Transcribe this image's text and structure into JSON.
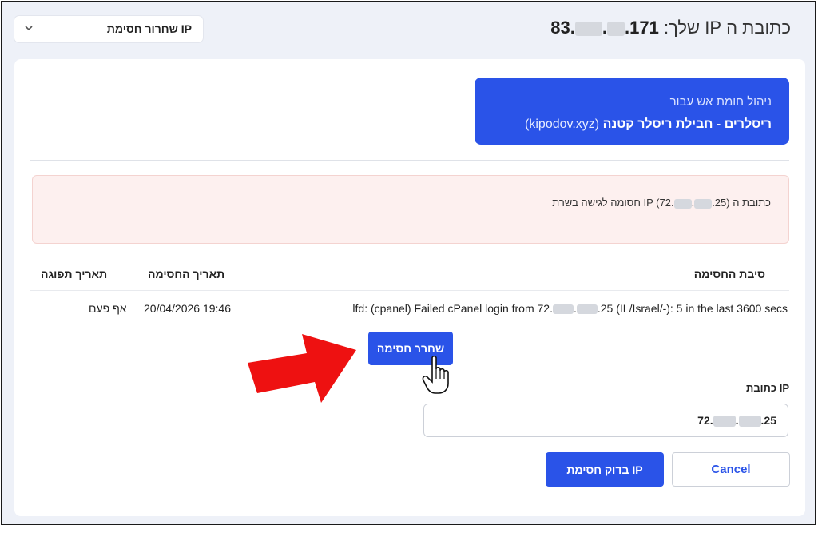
{
  "header": {
    "ip_label": "כתובת ה IP שלך:",
    "ip_prefix": "83.",
    "ip_suffix": ".171",
    "dropdown_label": "שחרור חסימת IP"
  },
  "brand": {
    "subtitle": "ניהול חומת אש עבור",
    "title": "ריסלרים - חבילת ריסלר קטנה",
    "domain": "(kipodov.xyz)"
  },
  "alert": {
    "text_start": "כתובת ה IP (72.",
    "text_end": ".25) חסומה לגישה בשרת"
  },
  "table": {
    "headers": {
      "reason": "סיבת החסימה",
      "block_date": "תאריך החסימה",
      "expiry_date": "תאריך תפוגה"
    },
    "row": {
      "reason_start": "lfd: (cpanel) Failed cPanel login from 72.",
      "reason_end": ".25 (IL/Israel/-): 5 in the last 3600 secs",
      "block_date": "20/04/2026 19:46",
      "expiry_date": "אף פעם"
    },
    "release_label": "שחרר חסימה"
  },
  "form": {
    "ip_label": "כתובת IP",
    "ip_prefix": "72.",
    "ip_suffix": ".25",
    "check_label": "בדוק חסימת IP",
    "cancel_label": "Cancel"
  },
  "colors": {
    "accent": "#2a53e8",
    "alert_bg": "#fdf0ef",
    "arrow": "#ee1111"
  },
  "icons": {
    "dropdown": "chevron-down-icon",
    "pointer": "hand-pointer-icon",
    "annotation": "red-arrow-icon"
  }
}
